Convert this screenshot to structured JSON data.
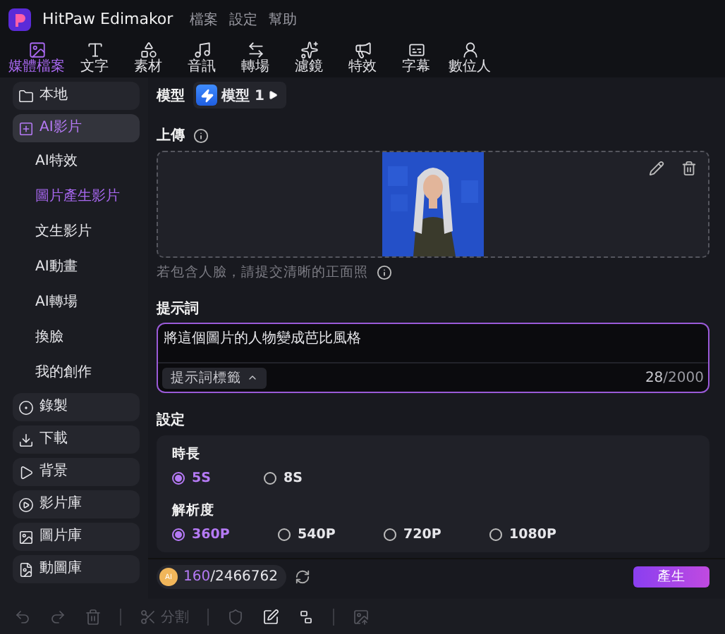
{
  "app": {
    "title": "HitPaw Edimakor"
  },
  "menu": [
    "檔案",
    "設定",
    "幫助"
  ],
  "toolbar": [
    {
      "label": "媒體檔案",
      "selected": true
    },
    {
      "label": "文字",
      "selected": false
    },
    {
      "label": "素材",
      "selected": false
    },
    {
      "label": "音訊",
      "selected": false
    },
    {
      "label": "轉場",
      "selected": false
    },
    {
      "label": "濾鏡",
      "selected": false
    },
    {
      "label": "特效",
      "selected": false
    },
    {
      "label": "字幕",
      "selected": false
    },
    {
      "label": "數位人",
      "selected": false
    }
  ],
  "sidebar": [
    {
      "label": "本地",
      "kind": "group",
      "selected": false
    },
    {
      "label": "AI影片",
      "kind": "group",
      "selected": true
    },
    {
      "label": "AI特效",
      "kind": "sub",
      "selected": false
    },
    {
      "label": "圖片產生影片",
      "kind": "sub",
      "selected": true
    },
    {
      "label": "文生影片",
      "kind": "sub",
      "selected": false
    },
    {
      "label": "AI動畫",
      "kind": "sub",
      "selected": false
    },
    {
      "label": "AI轉場",
      "kind": "sub",
      "selected": false
    },
    {
      "label": "換臉",
      "kind": "sub",
      "selected": false
    },
    {
      "label": "我的創作",
      "kind": "sub",
      "selected": false
    },
    {
      "label": "錄製",
      "kind": "group",
      "selected": false
    },
    {
      "label": "下載",
      "kind": "group",
      "selected": false
    },
    {
      "label": "背景",
      "kind": "group",
      "selected": false
    },
    {
      "label": "影片庫",
      "kind": "group",
      "selected": false
    },
    {
      "label": "圖片庫",
      "kind": "group",
      "selected": false
    },
    {
      "label": "動圖庫",
      "kind": "group",
      "selected": false
    }
  ],
  "model": {
    "label": "模型",
    "value": "模型 1"
  },
  "upload": {
    "label": "上傳",
    "hint": "若包含人臉，請提交清晰的正面照"
  },
  "prompt": {
    "label": "提示詞",
    "value": "將這個圖片的人物變成芭比風格",
    "tags_button": "提示詞標籤",
    "count": "28",
    "max": "/2000"
  },
  "settings": {
    "label": "設定",
    "groups": [
      {
        "label": "時長",
        "options": [
          {
            "label": "5S",
            "selected": true
          },
          {
            "label": "8S",
            "selected": false
          }
        ]
      },
      {
        "label": "解析度",
        "options": [
          {
            "label": "360P",
            "selected": true
          },
          {
            "label": "540P",
            "selected": false
          },
          {
            "label": "720P",
            "selected": false
          },
          {
            "label": "1080P",
            "selected": false
          }
        ]
      }
    ]
  },
  "credits": {
    "coin": "AI",
    "used": "160",
    "total": "/2466762"
  },
  "generate_button": "產生",
  "bottom_tools": [
    {
      "kind": "tool",
      "disabled": true
    },
    {
      "kind": "tool",
      "disabled": true
    },
    {
      "kind": "tool",
      "disabled": true
    },
    {
      "kind": "divider"
    },
    {
      "kind": "tool",
      "label": "分割",
      "disabled": true
    },
    {
      "kind": "divider"
    },
    {
      "kind": "tool",
      "disabled": true
    },
    {
      "kind": "tool",
      "disabled": false
    },
    {
      "kind": "tool",
      "disabled": false
    },
    {
      "kind": "divider"
    },
    {
      "kind": "tool",
      "disabled": true
    }
  ]
}
